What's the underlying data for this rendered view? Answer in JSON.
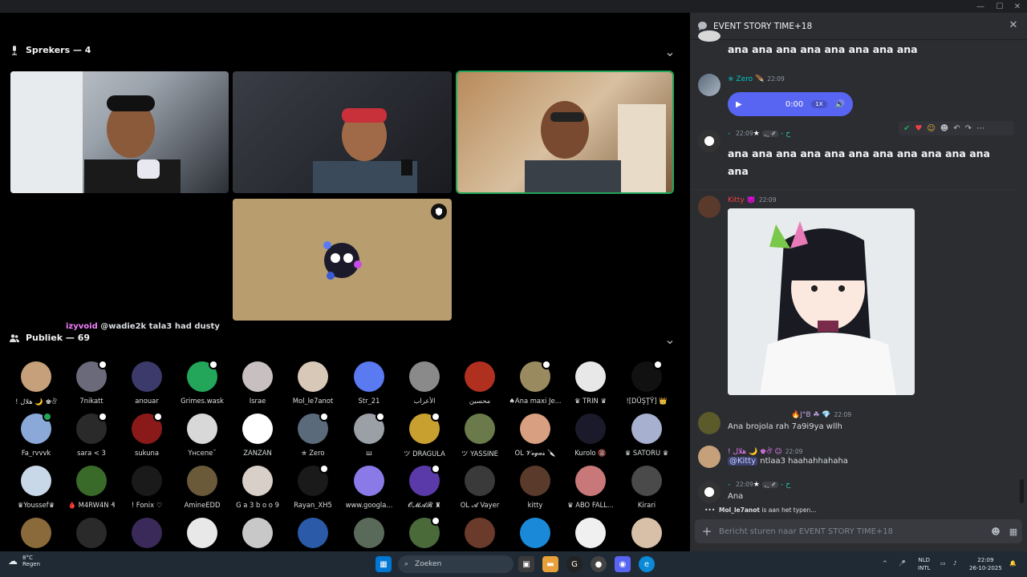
{
  "window": {
    "minimize": "—",
    "maximize": "☐",
    "close": "✕"
  },
  "stage": {
    "speakers_title": "Sprekers — 4",
    "audience_title": "Publiek — 69",
    "caption_user": "izyvoid",
    "caption_text": "@wadie2k tala3 had dusty"
  },
  "audience": [
    {
      "name": "! هلال 🌙 ♚ঔ",
      "color": "#c6a07a",
      "dot": false
    },
    {
      "name": "7nikatt",
      "color": "#6a6a7a",
      "dot": true
    },
    {
      "name": "anouar",
      "color": "#3b3a6a",
      "dot": false
    },
    {
      "name": "Grimes.wask",
      "color": "#23a55a",
      "dot": true
    },
    {
      "name": "Israe",
      "color": "#c8c0c0",
      "dot": false
    },
    {
      "name": "Mol_le7anot",
      "color": "#d8c8b8",
      "dot": false
    },
    {
      "name": "Str_21",
      "color": "#5a7af2",
      "dot": false
    },
    {
      "name": "الأعراب",
      "color": "#8a8a8a",
      "dot": false
    },
    {
      "name": "محسين",
      "color": "#b03020",
      "dot": false
    },
    {
      "name": "♠Ana maxi Je...",
      "color": "#9a8a60",
      "dot": true
    },
    {
      "name": "♛ TRIN ♛",
      "color": "#e8e8e8",
      "dot": false
    },
    {
      "name": "![DŪŞŢŸ] 👑",
      "color": "#111111",
      "dot": true
    },
    {
      "name": "Fa_rvvvk",
      "color": "#8aa8d8",
      "dot": true,
      "green": true
    },
    {
      "name": "sara < 3",
      "color": "#2a2a2a",
      "dot": true
    },
    {
      "name": "sukuna",
      "color": "#8a1a1a",
      "dot": true
    },
    {
      "name": "Үнсепе˘",
      "color": "#d8d8d8",
      "dot": false
    },
    {
      "name": "ZANZAN",
      "color": "#ffffff",
      "dot": false
    },
    {
      "name": "✯ Zero",
      "color": "#5a6a7a",
      "dot": true
    },
    {
      "name": "ш",
      "color": "#9aa0a6",
      "dot": true
    },
    {
      "name": "ツ DRAGULA",
      "color": "#c8a030",
      "dot": true
    },
    {
      "name": "ツ YASSINE",
      "color": "#6a7a4a",
      "dot": false
    },
    {
      "name": "OL 𝓥𝓮𝓰𝓪𝓼 🔪",
      "color": "#d8a080",
      "dot": false
    },
    {
      "name": "Kurolo 🔞",
      "color": "#1a1a2a",
      "dot": false
    },
    {
      "name": "♛ SATORU ♛",
      "color": "#a8b0d0",
      "dot": false
    },
    {
      "name": "♛Youssef♛",
      "color": "#c8d8e8",
      "dot": false
    },
    {
      "name": "🩸 M4RW4N ₰",
      "color": "#3a6a2a",
      "dot": false
    },
    {
      "name": "! Fonix ♡",
      "color": "#1a1a1a",
      "dot": false
    },
    {
      "name": "AmineEDD",
      "color": "#6a5a3a",
      "dot": false
    },
    {
      "name": "G a 3 b o o 9",
      "color": "#d8d0c8",
      "dot": false
    },
    {
      "name": "Rayan_XH5",
      "color": "#1a1a1a",
      "dot": true
    },
    {
      "name": "www.googla...",
      "color": "#8a7ae8",
      "dot": false
    },
    {
      "name": "𝓞𝓜𝓐𝓡 ♜",
      "color": "#5a3aa8",
      "dot": true
    },
    {
      "name": "OL 𝓐 Vayer",
      "color": "#3a3a3a",
      "dot": false
    },
    {
      "name": "kitty",
      "color": "#5a3a2a",
      "dot": false
    },
    {
      "name": "♛ ABO FALL...",
      "color": "#c87878",
      "dot": false
    },
    {
      "name": "Kirari",
      "color": "#4a4a4a",
      "dot": false
    },
    {
      "name": "",
      "color": "#8a6a3a",
      "dot": false
    },
    {
      "name": "",
      "color": "#2a2a2a",
      "dot": false
    },
    {
      "name": "",
      "color": "#3a2a5a",
      "dot": false
    },
    {
      "name": "",
      "color": "#e8e8e8",
      "dot": false
    },
    {
      "name": "",
      "color": "#c8c8c8",
      "dot": false
    },
    {
      "name": "",
      "color": "#2a5aa8",
      "dot": false
    },
    {
      "name": "",
      "color": "#5a6a5a",
      "dot": false
    },
    {
      "name": "",
      "color": "#4a6a3a",
      "dot": true
    },
    {
      "name": "",
      "color": "#6a3a2a",
      "dot": false
    },
    {
      "name": "",
      "color": "#1a8ad8",
      "dot": false
    },
    {
      "name": "",
      "color": "#f0f0f0",
      "dot": false
    },
    {
      "name": "",
      "color": "#d8c0a8",
      "dot": false
    }
  ],
  "chat": {
    "title": "EVENT STORY TIME+18",
    "top_text": "ana ana ana ana ana ana ana ana",
    "msg1": {
      "name": "✯ Zero 🪶",
      "time": "22:09"
    },
    "voice": {
      "time": "0:00",
      "rate": "1X"
    },
    "msg2": {
      "name": "- ح -",
      "tag": "✐ ﮼ﮩ",
      "time": "22:09",
      "text": "ana ana ana ana ana ana ana ana  ana ana ana ana"
    },
    "msg3": {
      "name": "Kitty 👿",
      "time": "22:09",
      "name_color": "#f23f43"
    },
    "msg4": {
      "name": "🔥J°B ☘ 💎",
      "time": "22:09",
      "text": "Ana brojola rah 7a9i9ya wllh"
    },
    "msg5": {
      "name": "! هلال 🌙 ♚ঔ ☺",
      "time": "22:09",
      "mention": "@Kitty",
      "text": " ntlaa3 haahahhahaha"
    },
    "msg6": {
      "name": "- ح -",
      "tag": "✐ ﮼ﮩ",
      "time": "22:09",
      "text": "Ana"
    },
    "typing_user": "Mol_le7anot",
    "typing_suffix": " is aan het typen...",
    "composer_placeholder": "Bericht sturen naar EVENT STORY TIME+18"
  },
  "taskbar": {
    "temp": "8°C",
    "weather": "Regen",
    "search": "Zoeken",
    "lang1": "NLD",
    "lang2": "INTL",
    "time": "22:09",
    "date": "26-10-2025"
  }
}
